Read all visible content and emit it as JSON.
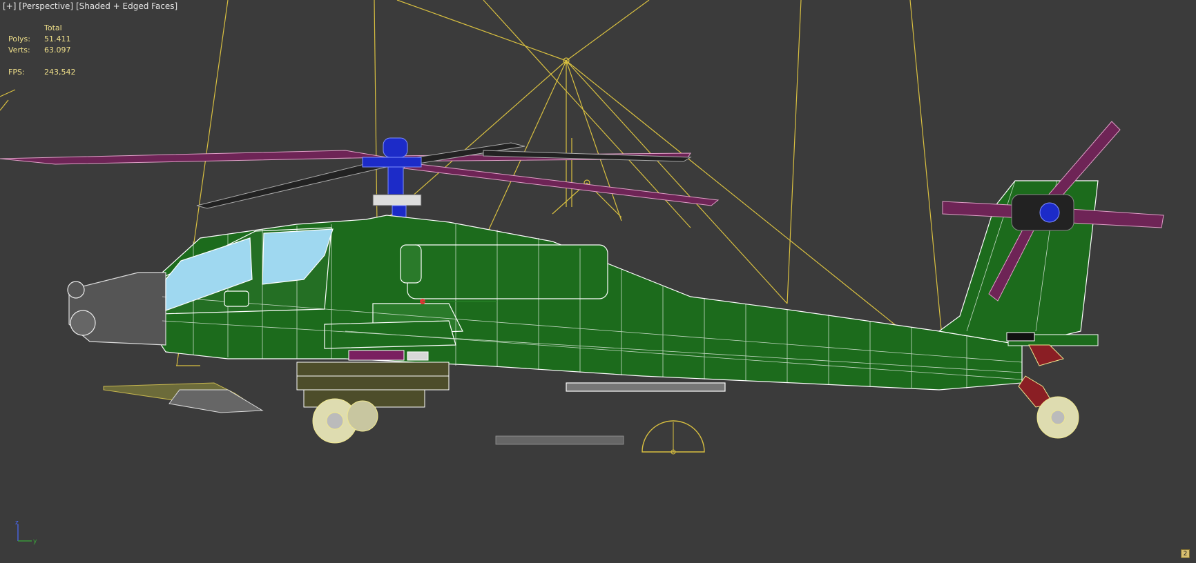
{
  "viewport": {
    "label_plus": "[+]",
    "label_view": "[Perspective]",
    "label_shading": "[Shaded + Edged Faces]"
  },
  "stats": {
    "header": "Total",
    "polys_label": "Polys:",
    "polys_value": "51.411",
    "verts_label": "Verts:",
    "verts_value": "63.097",
    "fps_label": "FPS:",
    "fps_value": "243,542"
  },
  "axis": {
    "z_label": "z",
    "y_label": "y"
  },
  "corner_button": {
    "label": "2"
  },
  "colors": {
    "background": "#3b3b3b",
    "light_wire": "#d9c040",
    "body_green": "#1c6b1c",
    "rotor_blade": "#6e2456",
    "rotor_hub": "#1c2bc8",
    "canopy": "#9fd8f0",
    "stats_text": "#f0e08a"
  }
}
